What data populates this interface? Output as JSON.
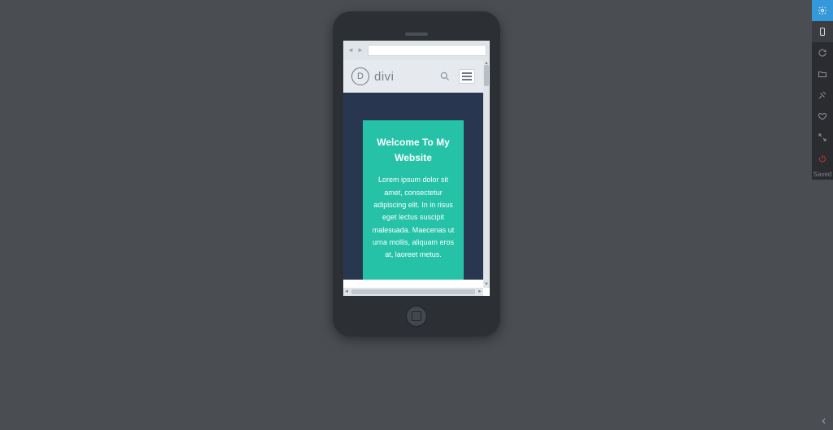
{
  "sidebar": {
    "saved_label": "Saved",
    "items": [
      {
        "name": "settings",
        "active": true
      },
      {
        "name": "mobile",
        "highlight": true
      },
      {
        "name": "refresh"
      },
      {
        "name": "folder"
      },
      {
        "name": "tools"
      },
      {
        "name": "heart"
      },
      {
        "name": "expand"
      },
      {
        "name": "power",
        "danger": true
      }
    ]
  },
  "browser": {
    "url": ""
  },
  "site": {
    "logo_letter": "D",
    "logo_text": "divi"
  },
  "hero": {
    "title": "Welcome To My Website",
    "body": "Lorem ipsum dolor sit amet, consectetur adipiscing elit. In in risus eget lectus suscipit malesuada. Maecenas ut urna mollis, aliquam eros at, laoreet metus."
  }
}
